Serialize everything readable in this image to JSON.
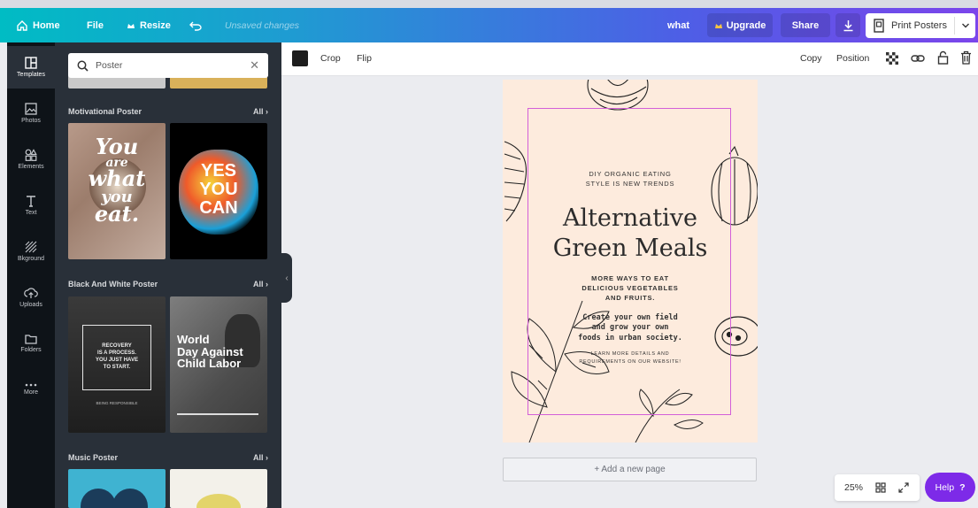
{
  "topbar": {
    "home_label": "Home",
    "file_label": "File",
    "resize_label": "Resize",
    "unsaved_label": "Unsaved changes",
    "doc_title": "what",
    "upgrade_label": "Upgrade",
    "share_label": "Share",
    "print_label": "Print Posters"
  },
  "rail": {
    "items": [
      {
        "label": "Templates",
        "icon": "templates-icon"
      },
      {
        "label": "Photos",
        "icon": "photos-icon"
      },
      {
        "label": "Elements",
        "icon": "elements-icon"
      },
      {
        "label": "Text",
        "icon": "text-icon"
      },
      {
        "label": "Bkground",
        "icon": "background-icon"
      },
      {
        "label": "Uploads",
        "icon": "uploads-icon"
      },
      {
        "label": "Folders",
        "icon": "folders-icon"
      },
      {
        "label": "More",
        "icon": "more-icon"
      }
    ]
  },
  "panel": {
    "search_value": "Poster",
    "all_label": "All",
    "sections": [
      {
        "title": "Motivational Poster"
      },
      {
        "title": "Black And White Poster"
      },
      {
        "title": "Music Poster"
      }
    ],
    "thumbs": {
      "you_are": [
        "You",
        "are",
        "what",
        "you",
        "eat."
      ],
      "yes_you_can": [
        "YES",
        "YOU",
        "CAN"
      ],
      "recovery": [
        "RECOVERY",
        "IS A PROCESS.",
        "YOU JUST HAVE",
        "TO START."
      ],
      "recovery_footer": "BEING RESPONSIBLE",
      "world_day": [
        "World",
        "Day Against",
        "Child Labor"
      ]
    }
  },
  "toolbar": {
    "crop_label": "Crop",
    "flip_label": "Flip",
    "copy_label": "Copy",
    "position_label": "Position",
    "color": "#1d1d1d"
  },
  "poster": {
    "kicker_1": "DIY ORGANIC EATING",
    "kicker_2": "STYLE IS NEW TRENDS",
    "title_1": "Alternative",
    "title_2": "Green Meals",
    "sub_1": "MORE WAYS TO EAT",
    "sub_2": "DELICIOUS VEGETABLES",
    "sub_3": "AND FRUITS.",
    "body_1": "Create your own field",
    "body_2": "and grow your own",
    "body_3": "foods in urban society.",
    "cta_1": "LEARN MORE DETAILS AND",
    "cta_2": "REQUIREMENTS ON OUR WEBSITE!",
    "bg_color": "#fdebdd"
  },
  "add_page_label": "+ Add a new page",
  "zoom_label": "25%",
  "help_label": "Help",
  "help_glyph": "?",
  "colors": {
    "accent": "#7d2ae8",
    "upgrade_star": "#f7c544",
    "selection": "#d35fd8"
  }
}
